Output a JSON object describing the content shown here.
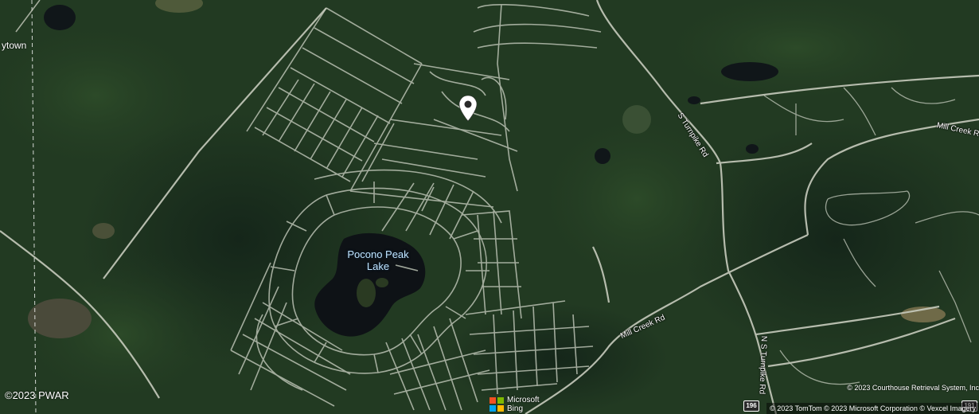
{
  "map": {
    "town_label": "ytown",
    "lake_label_line1": "Pocono Peak",
    "lake_label_line2": "Lake",
    "road_labels": {
      "turnpike_north": "S Turnpike Rd",
      "turnpike_south": "N S Turnpike Rd",
      "mill_creek_lower": "Mill Creek Rd",
      "mill_creek_upper": "Mill Creek Rd"
    },
    "route_shields": [
      "196",
      "191"
    ]
  },
  "attribution": {
    "watermark": "©2023 PWAR",
    "brand_line1": "Microsoft",
    "brand_line2": "Bing",
    "copyright_line1": "© 2023 Courthouse Retrieval System, Inc",
    "copyright_line2": "© 2023 TomTom © 2023 Microsoft Corporation © Vexcel Imagery"
  },
  "colors": {
    "forest": "#1f3520",
    "lake": "#0e1216",
    "road": "#b9c0b2",
    "pin": "#ffffff",
    "lake_label": "#bfe4ff"
  },
  "icons": {
    "pin": "location-pin-icon",
    "logo": "microsoft-logo-icon"
  }
}
